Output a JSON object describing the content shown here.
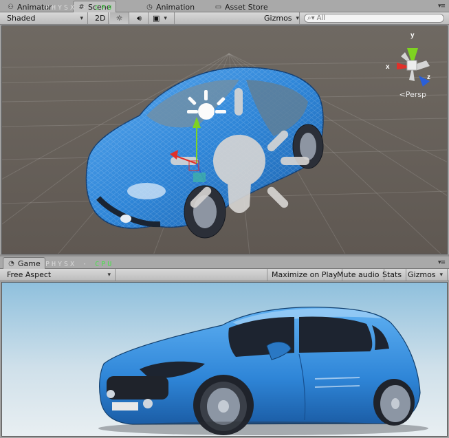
{
  "top_tabs": [
    {
      "label": "Animator",
      "icon": "animator-icon"
    },
    {
      "label": "Scene",
      "icon": "grid-icon"
    },
    {
      "label": "Animation",
      "icon": "clock-icon"
    },
    {
      "label": "Asset Store",
      "icon": "store-icon"
    }
  ],
  "watermark": {
    "left": "PHYSX",
    "sep": "·",
    "right": "CPU"
  },
  "scene_toolbar": {
    "shading_mode": "Shaded",
    "mode_2d": "2D",
    "lighting_icon": "sun-icon",
    "audio_icon": "speaker-icon",
    "effects_icon": "image-icon",
    "gizmos_label": "Gizmos",
    "search_placeholder": "All"
  },
  "scene_gizmo": {
    "x_label": "x",
    "y_label": "y",
    "z_label": "z",
    "projection": "Persp"
  },
  "bottom_tabs": [
    {
      "label": "Game",
      "icon": "pacman-icon"
    }
  ],
  "game_toolbar": {
    "aspect": "Free Aspect",
    "maximize_on_play": "Maximize on Play",
    "mute_audio": "Mute audio",
    "stats": "Stats",
    "gizmos": "Gizmos"
  },
  "colors": {
    "scene_bg": "#6d655e",
    "car_blue": "#2f86d8",
    "sky_top": "#8fc0dd",
    "sky_bottom": "#e9eff2",
    "axis_x": "#e0302a",
    "axis_y": "#7ed321",
    "axis_z": "#2a5fd8"
  }
}
